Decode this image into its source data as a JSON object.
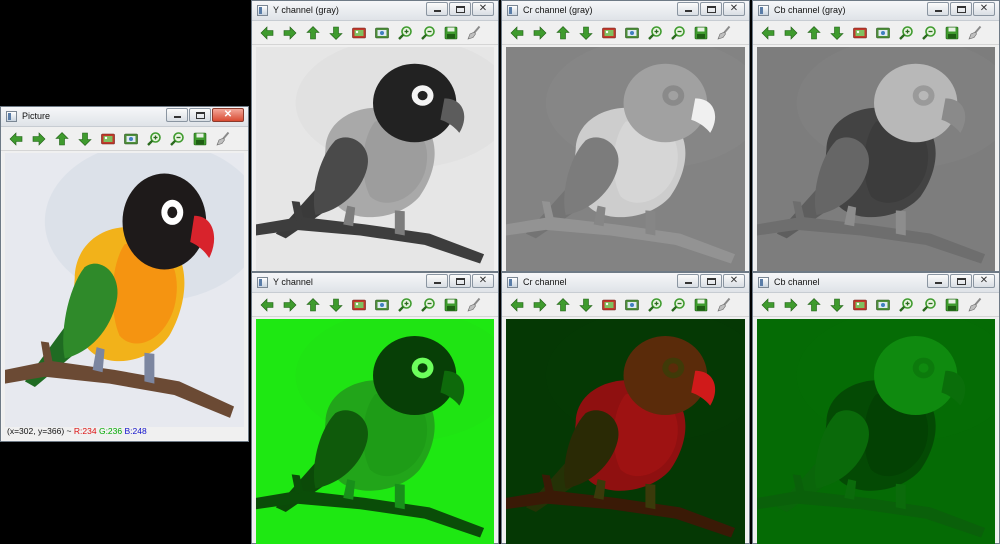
{
  "windows": {
    "picture": {
      "title": "Picture"
    },
    "y_gray": {
      "title": "Y channel (gray)"
    },
    "cr_gray": {
      "title": "Cr channel (gray)"
    },
    "cb_gray": {
      "title": "Cb channel (gray)"
    },
    "y_color": {
      "title": "Y channel"
    },
    "cr_color": {
      "title": "Cr channel"
    },
    "cb_color": {
      "title": "Cb channel"
    }
  },
  "toolbar_icons": [
    "arrow-left-icon",
    "arrow-right-icon",
    "arrow-up-icon",
    "arrow-down-icon",
    "zoom-fit-icon",
    "zoom-original-icon",
    "zoom-in-icon",
    "zoom-out-icon",
    "save-icon",
    "properties-brush-icon"
  ],
  "status": {
    "coords": "(x=302, y=366) ~",
    "r": "R:234",
    "g": "G:236",
    "b": "B:248"
  },
  "colors": {
    "picture_bg": "#e7e9ef",
    "y_gray_bg": "#e6e6e6",
    "cr_gray_bg": "#838383",
    "cb_gray_bg": "#7d7d7d",
    "y_color_bg": "#1ee812",
    "cr_color_bg": "#053804",
    "cb_color_bg": "#056b05",
    "toolbar_green": "#3f9b2e"
  }
}
